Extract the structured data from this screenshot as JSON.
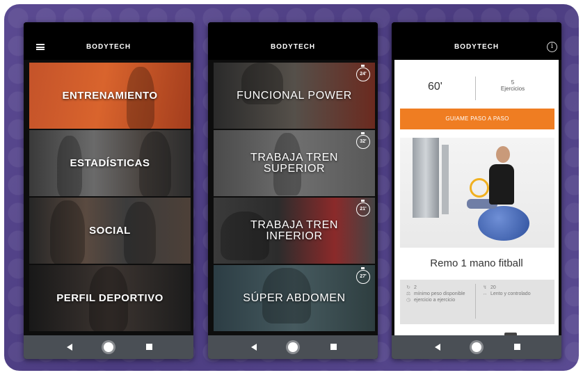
{
  "brand": "BODYTECH",
  "screen1": {
    "tiles": [
      {
        "label": "ENTRENAMIENTO"
      },
      {
        "label": "ESTADÍSTICAS"
      },
      {
        "label": "SOCIAL"
      },
      {
        "label": "PERFIL DEPORTIVO"
      }
    ]
  },
  "screen2": {
    "tiles": [
      {
        "label": "FUNCIONAL POWER",
        "minutes": "24'"
      },
      {
        "label": "TRABAJA TREN SUPERIOR",
        "minutes": "32'"
      },
      {
        "label": "TRABAJA TREN INFERIOR",
        "minutes": "21'"
      },
      {
        "label": "SÚPER ABDOMEN",
        "minutes": "27'"
      }
    ]
  },
  "screen3": {
    "duration": "60'",
    "exercise_count": "5",
    "exercise_count_label": "Ejercicios",
    "cta_label": "GUIAME PASO A PASO",
    "exercise_name": "Remo 1 mano fitball",
    "specs": {
      "sets": "2",
      "weight_note": "mínimo peso disponible",
      "exercise_note": "ejercicio a ejercicio",
      "reps": "20",
      "tempo": "Lento y controlado"
    }
  },
  "icons": {
    "menu": "hamburger-menu-icon",
    "info": "info-icon",
    "timer": "stopwatch-icon",
    "nav_back": "back-triangle-icon",
    "nav_home": "home-circle-icon",
    "nav_recent": "recent-apps-square-icon"
  },
  "colors": {
    "accent_orange": "#ef7d22",
    "frame_purple": "#4b3c80",
    "navbar": "#4a4f55"
  }
}
